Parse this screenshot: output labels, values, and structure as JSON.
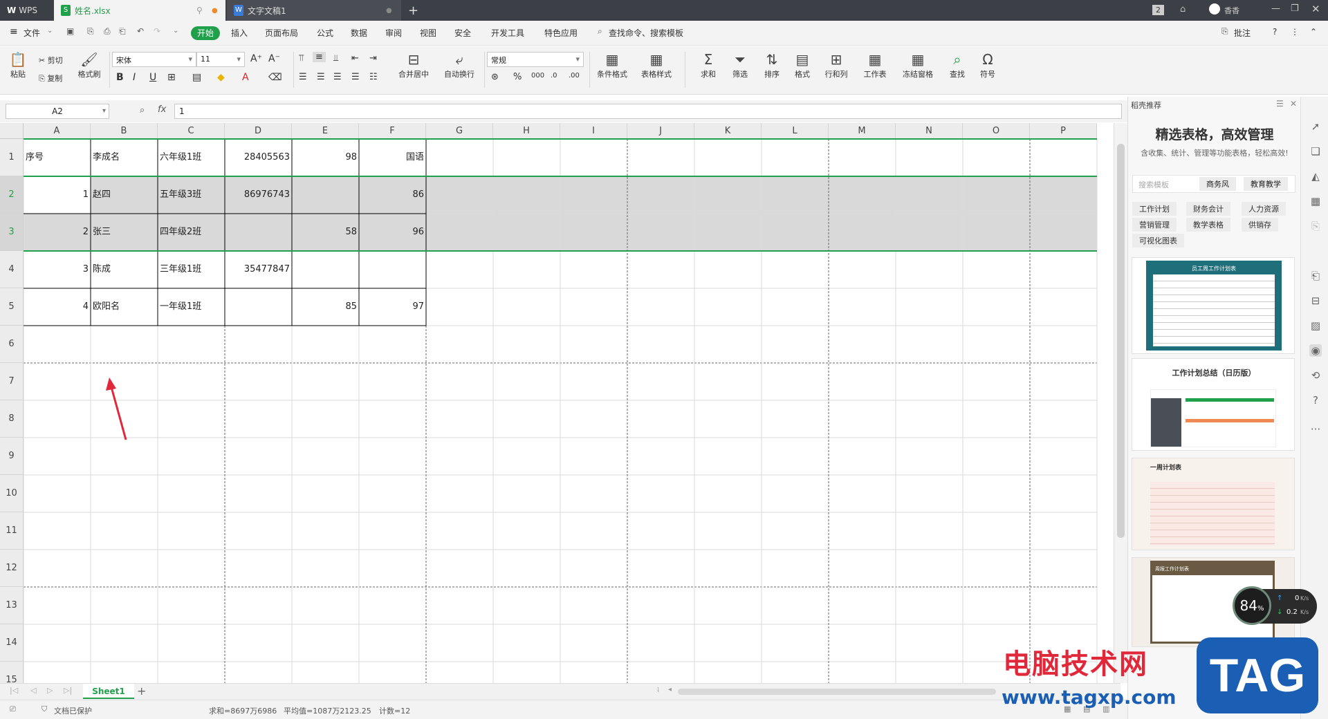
{
  "titlebar": {
    "app_tab": "WPS",
    "active_tab": "姓名.xlsx",
    "doc_tab": "文字文稿1",
    "new_tab": "+",
    "badge": "2",
    "user": "香香"
  },
  "menu": {
    "file": "文件",
    "start": "开始",
    "items": [
      "插入",
      "页面布局",
      "公式",
      "数据",
      "审阅",
      "视图",
      "安全",
      "开发工具",
      "特色应用"
    ],
    "search": "查找命令、搜索模板",
    "comment": "批注",
    "help": "?"
  },
  "ribbon": {
    "paste": "粘贴",
    "cut": "剪切",
    "copy": "复制",
    "format_painter": "格式刷",
    "font_name": "宋体",
    "font_size": "11",
    "merge_center": "合并居中",
    "wrap_text": "自动换行",
    "number_format": "常规",
    "conditional_format": "条件格式",
    "table_style": "表格样式",
    "sum": "求和",
    "filter": "筛选",
    "sort": "排序",
    "format": "格式",
    "row_col": "行和列",
    "worksheet": "工作表",
    "freeze": "冻结窗格",
    "find": "查找",
    "symbol": "符号"
  },
  "formula_bar": {
    "name_box": "A2",
    "fx": "fx",
    "value": "1"
  },
  "columns": [
    "A",
    "B",
    "C",
    "D",
    "E",
    "F",
    "G",
    "H",
    "I",
    "J",
    "K",
    "L",
    "M",
    "N",
    "O",
    "P"
  ],
  "rows": [
    "1",
    "2",
    "3",
    "4",
    "5",
    "6",
    "7",
    "8",
    "9",
    "10",
    "11",
    "12",
    "13",
    "14",
    "15"
  ],
  "cells": {
    "r1": [
      "序号",
      "李成名",
      "六年级1班",
      "28405563",
      "98",
      "国语"
    ],
    "r2": [
      "1",
      "赵四",
      "五年级3班",
      "86976743",
      "",
      "86"
    ],
    "r3": [
      "2",
      "张三",
      "四年级2班",
      "",
      "58",
      "96"
    ],
    "r4": [
      "3",
      "陈成",
      "三年级1班",
      "35477847",
      "",
      ""
    ],
    "r5": [
      "4",
      "欧阳名",
      "一年级1班",
      "",
      "85",
      "97"
    ]
  },
  "sheet": {
    "tab": "Sheet1",
    "add": "+"
  },
  "status": {
    "protected": "文档已保护",
    "sum": "求和=8697万6986",
    "average": "平均值=1087万2123.25",
    "count": "计数=12"
  },
  "panel": {
    "header": "稻壳推荐",
    "title": "精选表格，高效管理",
    "subtitle": "含收集、统计、管理等功能表格，轻松高效!",
    "search_placeholder": "搜索模板",
    "search_tags": [
      "商务风",
      "教育教学"
    ],
    "categories": [
      "工作计划",
      "财务会计",
      "人力资源",
      "营销管理",
      "教学表格",
      "供销存",
      "可视化图表"
    ],
    "templates": [
      "员工周工作计划表",
      "工作计划总结（日历版）",
      "一周计划表",
      "周报工作计划表"
    ]
  },
  "overlay": {
    "cpu": "84",
    "percent": "%",
    "up": "0",
    "down": "0.2",
    "unit": "K/s",
    "watermark_cn": "电脑技术网",
    "watermark_url": "www.tagxp.com",
    "watermark_tag": "TAG"
  },
  "colors": {
    "accent": "#21a04b",
    "titlebar": "#3c3f45",
    "selection": "#d9d9d9",
    "arrow": "#e0283a"
  }
}
